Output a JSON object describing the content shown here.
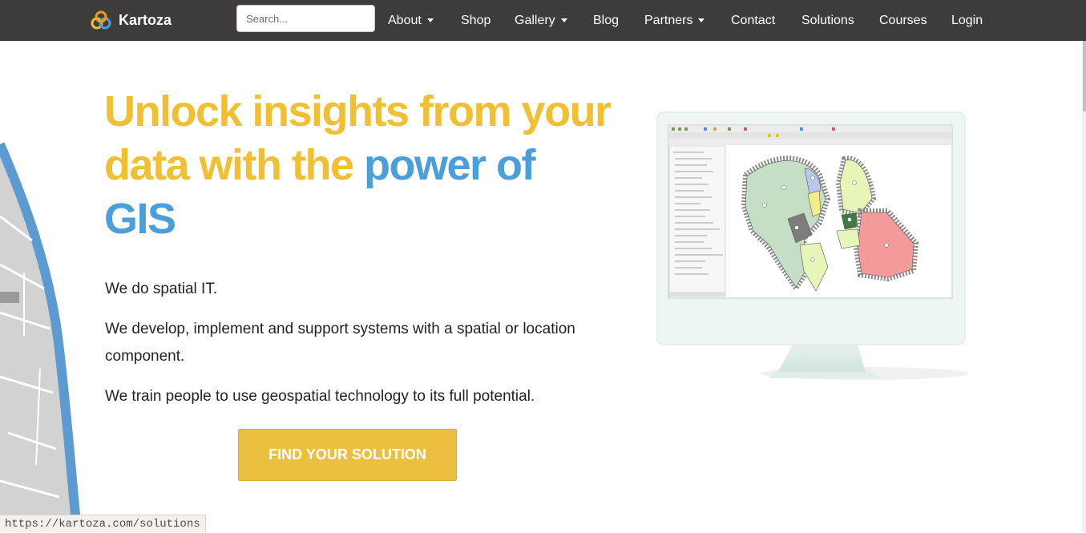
{
  "brand": {
    "name": "Kartoza"
  },
  "search": {
    "placeholder": "Search..."
  },
  "nav": [
    {
      "label": "About",
      "dropdown": true
    },
    {
      "label": "Shop",
      "dropdown": false
    },
    {
      "label": "Gallery",
      "dropdown": true
    },
    {
      "label": "Blog",
      "dropdown": false
    },
    {
      "label": "Partners",
      "dropdown": true
    },
    {
      "label": "Contact",
      "dropdown": false
    },
    {
      "label": "Solutions",
      "dropdown": false
    },
    {
      "label": "Courses",
      "dropdown": false
    },
    {
      "label": "Login",
      "dropdown": false
    }
  ],
  "hero": {
    "headline_yellow_1": "Unlock insights from your",
    "headline_yellow_2": "data with the ",
    "headline_blue_2": "power of",
    "headline_blue_3": "GIS",
    "p1": "We do spatial IT.",
    "p2_line1": "We develop, implement and support systems with a spatial or location",
    "p2_line2": "component.",
    "p3": "We train people to use geospatial technology to its full potential.",
    "cta": "FIND YOUR SOLUTION"
  },
  "status": {
    "url": "https://kartoza.com/solutions"
  },
  "colors": {
    "navbar": "#3d3b3c",
    "yellow": "#f1bf32",
    "blue": "#4a9fda",
    "cta": "#ebbf3f"
  },
  "icons": {
    "logo": "kartoza-logo-icon",
    "caret": "chevron-down-icon"
  }
}
